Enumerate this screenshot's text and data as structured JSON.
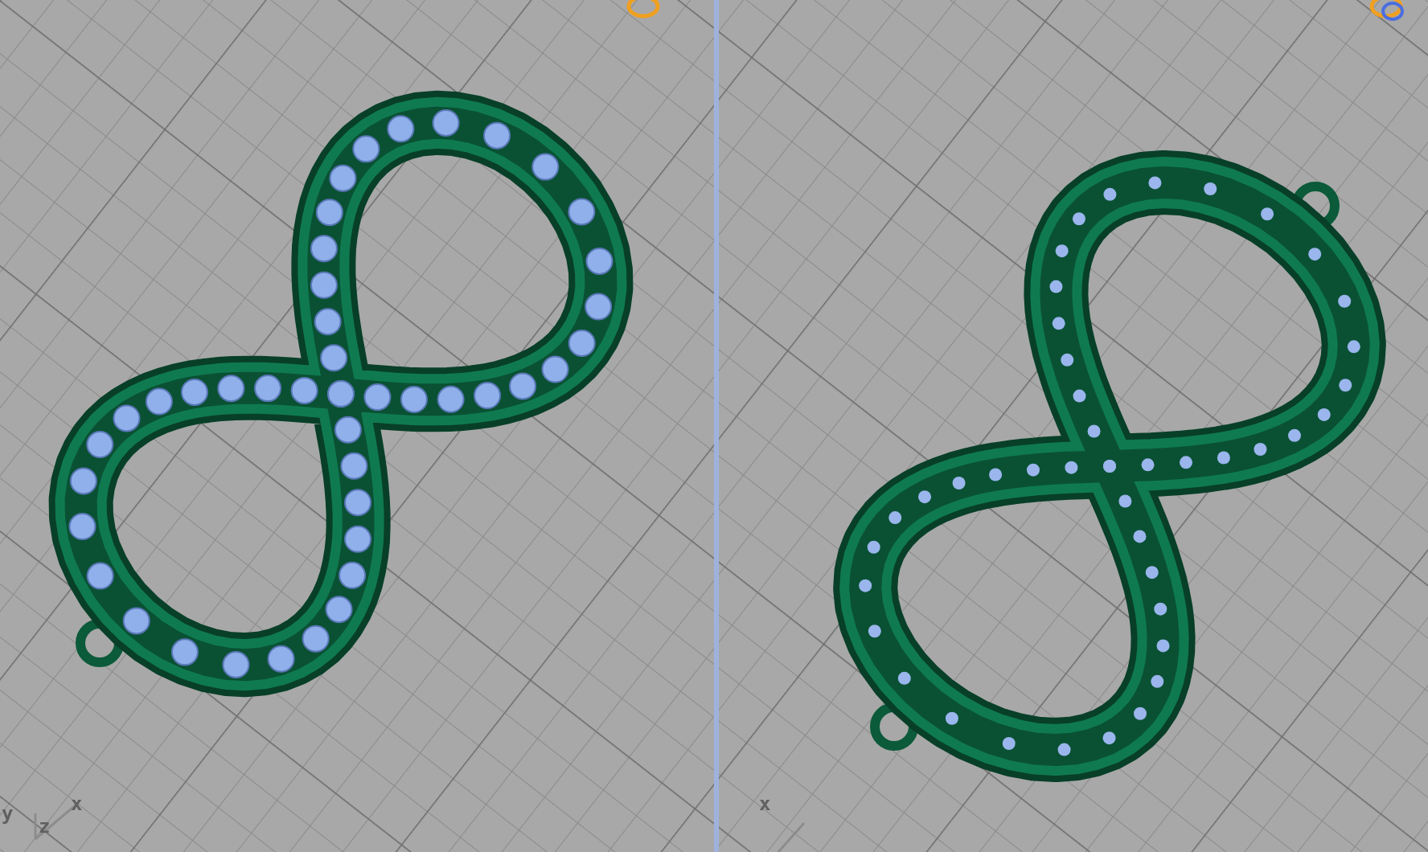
{
  "viewports": [
    {
      "axis_labels": [
        "y",
        "z",
        "x"
      ],
      "kind": "set"
    },
    {
      "axis_labels": [
        "x"
      ],
      "kind": "channel"
    }
  ]
}
